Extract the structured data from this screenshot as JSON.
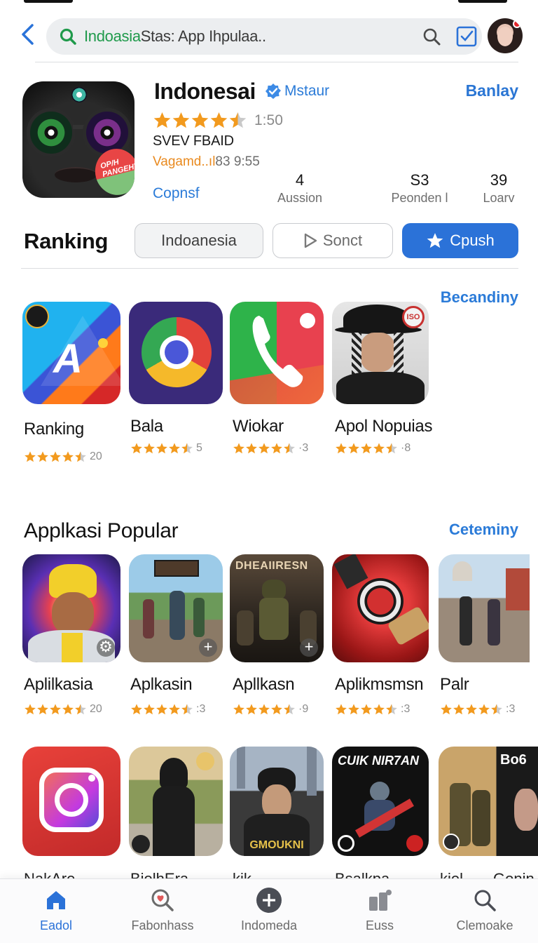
{
  "search": {
    "query_highlight": "Indoasia",
    "query_rest": "Stas: App Ihpulaa.."
  },
  "app": {
    "title": "Indonesai",
    "developer": "Mstaur",
    "action": "Banlay",
    "rating_text": "1:50",
    "rating": 4.5,
    "line1": "SVEV FBAID",
    "line2_highlight": "Vagamd..ıl",
    "line2_rest": "83 9:55",
    "link": "Copnsf",
    "stats": [
      {
        "value": "4",
        "label": "Aussion"
      },
      {
        "value": "S3",
        "label": "Peonden l"
      },
      {
        "value": "39",
        "label": "Loarv"
      }
    ]
  },
  "ranking": {
    "title": "Ranking",
    "chips": [
      "Indoanesia",
      "Sonct",
      "Cpush"
    ],
    "see_more": "Becandiny",
    "apps": [
      {
        "name": "Ranking",
        "count": "20"
      },
      {
        "name": "Bala",
        "count": "5"
      },
      {
        "name": "Wiokar",
        "count": "·3"
      },
      {
        "name": "Apol Nopuias",
        "count": "·8"
      }
    ]
  },
  "popular": {
    "title": "Applkasi Popular",
    "see_more": "Ceteminy",
    "apps": [
      {
        "name": "Aplilkasia",
        "count": "20"
      },
      {
        "name": "Aplkasin",
        "count": ":3"
      },
      {
        "name": "Apllkasn",
        "count": "·9"
      },
      {
        "name": "Aplikmsmsn",
        "count": ":3"
      },
      {
        "name": "Palr",
        "count": ":3"
      }
    ],
    "banner_texts": [
      "DHEAIIRESN",
      "CUIK NIR7AN",
      "GMOUKNI",
      "Bo6"
    ]
  },
  "peek_labels": [
    "NakAre",
    "BiolhEra",
    "kik",
    "Bsalkpa",
    "kiel",
    "Gonin"
  ],
  "nav": [
    {
      "label": "Eadol",
      "icon": "home-icon",
      "active": true
    },
    {
      "label": "Fabonhass",
      "icon": "search-heart-icon",
      "active": false
    },
    {
      "label": "Indomeda",
      "icon": "plus-circle-icon",
      "active": false
    },
    {
      "label": "Euss",
      "icon": "apps-icon",
      "active": false
    },
    {
      "label": "Clemoake",
      "icon": "search-icon",
      "active": false
    }
  ],
  "colors": {
    "accent": "#2b72d8",
    "star": "#f29a1e",
    "search_green": "#1f9a4b"
  }
}
